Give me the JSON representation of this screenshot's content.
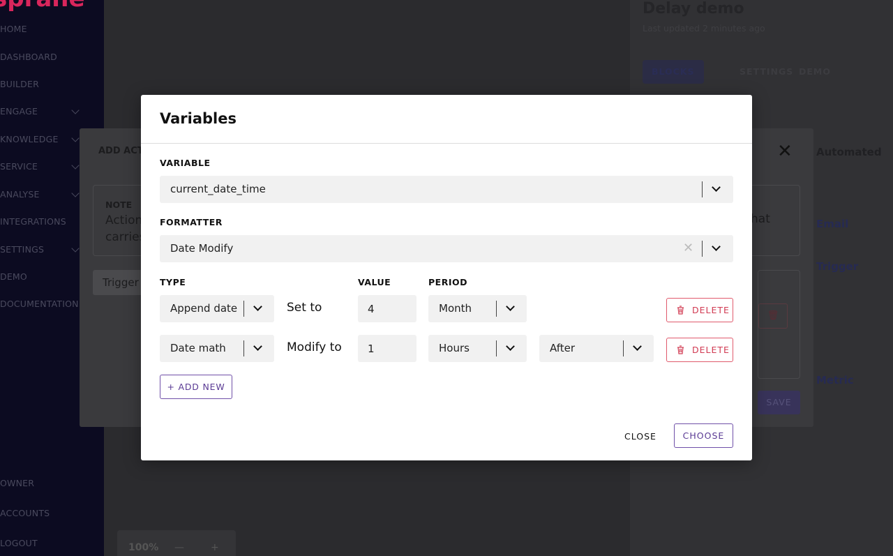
{
  "colors": {
    "sidebar_bg": "#0c0b21",
    "brand": "#d9265c",
    "accent_purple": "#6f4fa8",
    "danger": "#d13a52",
    "field_bg": "#f1f1f1"
  },
  "sidebar": {
    "logo": "sprane",
    "items": [
      {
        "label": "HOME"
      },
      {
        "label": "DASHBOARD"
      },
      {
        "label": "BUILDER"
      },
      {
        "label": "ENGAGE"
      },
      {
        "label": "KNOWLEDGE"
      },
      {
        "label": "SERVICE"
      },
      {
        "label": "ANALYSE"
      },
      {
        "label": "INTEGRATIONS"
      },
      {
        "label": "SETTINGS"
      },
      {
        "label": "DEMO"
      },
      {
        "label": "DOCUMENTATION"
      }
    ],
    "bottom_items": [
      {
        "label": "OWNER"
      },
      {
        "label": "ACCOUNTS"
      },
      {
        "label": "LOGOUT"
      }
    ]
  },
  "canvas": {
    "zoom": "100%",
    "zoom_out": "—",
    "zoom_in": "+"
  },
  "right_panel": {
    "title": "Delay demo",
    "subtitle": "Last updated 2 minutes ago",
    "tabs": [
      "BLOCKS",
      "SETTINGS",
      "DEMO"
    ],
    "links": [
      "Automated",
      "Email",
      "Trigger",
      "Metric"
    ]
  },
  "action_dialog": {
    "title": "ADD ACT",
    "note_label": "NOTE",
    "note_text": "Action carries",
    "note_tail": "hat",
    "trigger_label": "Trigger",
    "save_label": "SAVE"
  },
  "variables_modal": {
    "title": "Variables",
    "variable_label": "VARIABLE",
    "variable_value": "current_date_time",
    "formatter_label": "FORMATTER",
    "formatter_value": "Date Modify",
    "type_label": "TYPE",
    "value_label": "VALUE",
    "period_label": "PERIOD",
    "rows": [
      {
        "type": "Append date",
        "action_text": "Set to",
        "value": "4",
        "period": "Month",
        "delete_label": "DELETE"
      },
      {
        "type": "Date math",
        "action_text": "Modify to",
        "value": "1",
        "period": "Hours",
        "direction": "After",
        "delete_label": "DELETE"
      }
    ],
    "add_new_label": "+ ADD NEW",
    "close_label": "CLOSE",
    "choose_label": "CHOOSE"
  }
}
